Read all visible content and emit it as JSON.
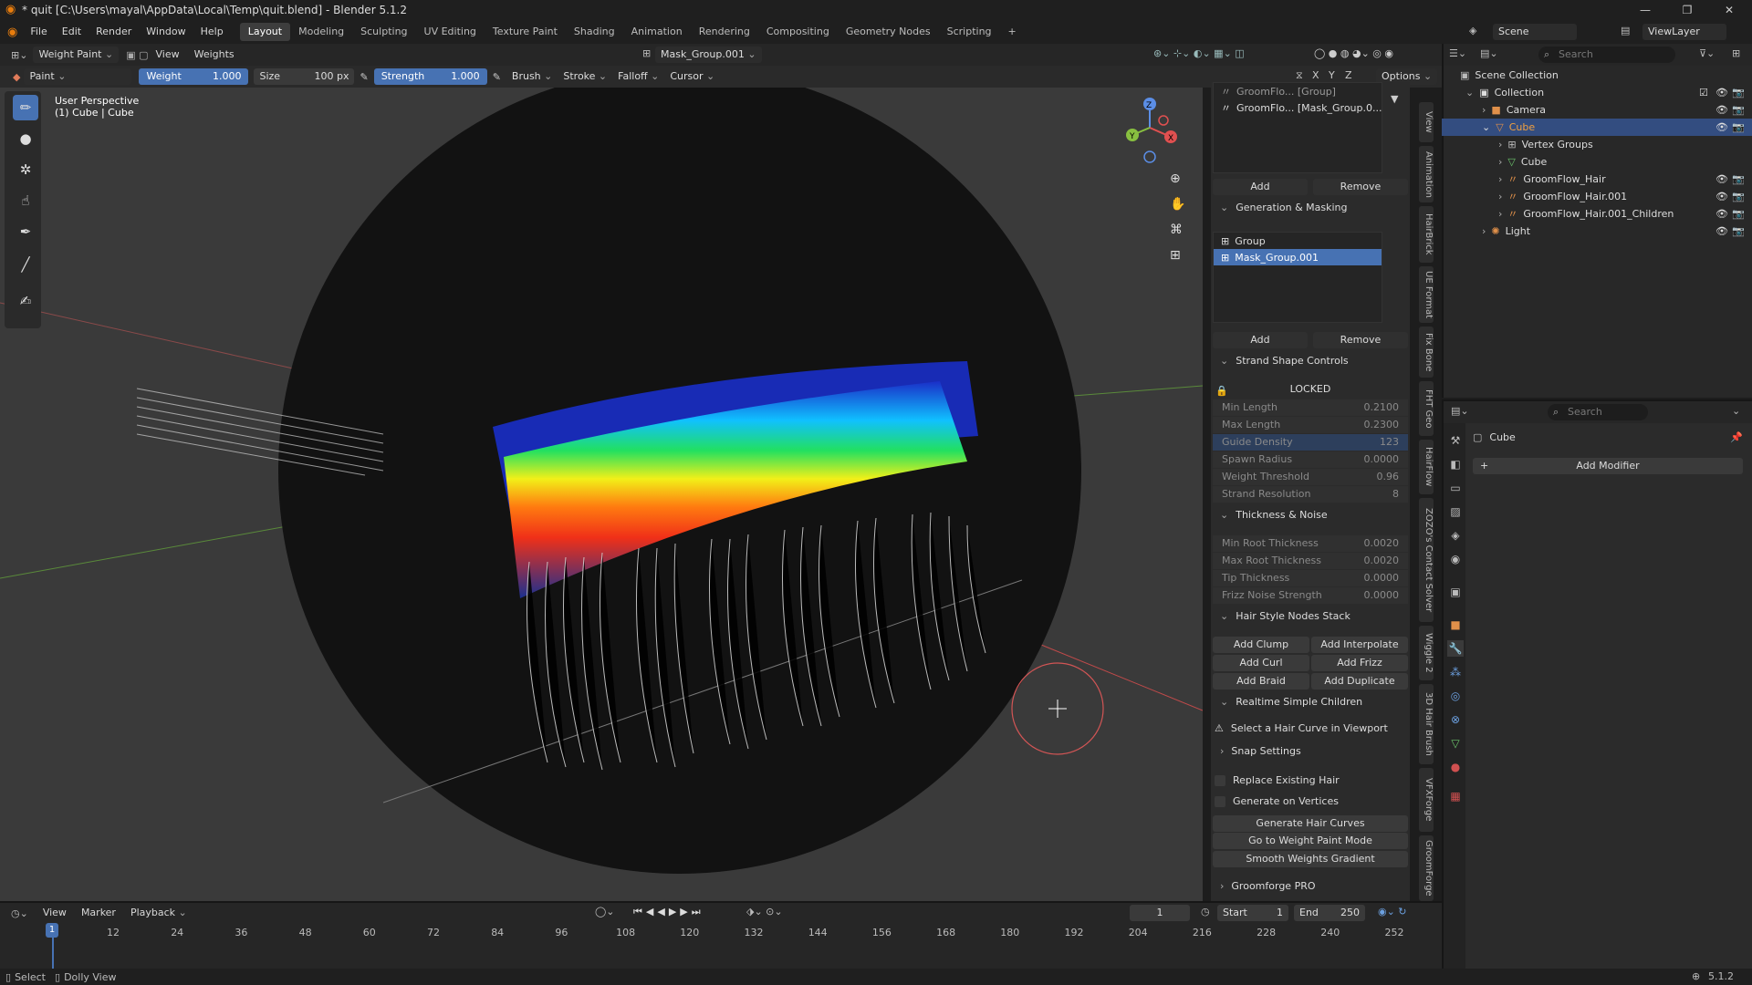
{
  "window": {
    "title": "* quit [C:\\Users\\mayal\\AppData\\Local\\Temp\\quit.blend] - Blender 5.1.2",
    "minimize": "—",
    "maximize": "❐",
    "close": "✕"
  },
  "menu": [
    "File",
    "Edit",
    "Render",
    "Window",
    "Help"
  ],
  "workspaces": [
    "Layout",
    "Modeling",
    "Sculpting",
    "UV Editing",
    "Texture Paint",
    "Shading",
    "Animation",
    "Rendering",
    "Compositing",
    "Geometry Nodes",
    "Scripting",
    "+"
  ],
  "scene": {
    "name": "Scene",
    "viewlayer": "ViewLayer"
  },
  "viewport_header": {
    "mode": "Weight Paint",
    "view": "View",
    "weights": "Weights",
    "vgroup": "Mask_Group.001"
  },
  "tool_header": {
    "brush_name": "Paint",
    "weight_label": "Weight",
    "weight_value": "1.000",
    "size_label": "Size",
    "size_value": "100 px",
    "strength_label": "Strength",
    "strength_value": "1.000",
    "brush": "Brush",
    "stroke": "Stroke",
    "falloff": "Falloff",
    "cursor": "Cursor",
    "options": "Options",
    "x": "X",
    "y": "Y",
    "z": "Z"
  },
  "overlay": {
    "line1": "User Perspective",
    "line2": "(1) Cube | Cube"
  },
  "gizmo": {
    "x": "X",
    "y": "Y",
    "z": "Z"
  },
  "npanel": {
    "list1": [
      {
        "name": "GroomFlo...",
        "detail": "[Group]"
      },
      {
        "name": "GroomFlo...",
        "detail": "[Mask_Group.0..."
      }
    ],
    "add": "Add",
    "remove": "Remove",
    "gen_title": "Generation & Masking",
    "list2": [
      "Group",
      "Mask_Group.001"
    ],
    "strand_title": "Strand Shape Controls",
    "locked": "LOCKED",
    "strand_fields": [
      {
        "label": "Min Length",
        "value": "0.2100"
      },
      {
        "label": "Max Length",
        "value": "0.2300"
      },
      {
        "label": "Guide Density",
        "value": "123"
      },
      {
        "label": "Spawn Radius",
        "value": "0.0000"
      },
      {
        "label": "Weight Threshold",
        "value": "0.96"
      },
      {
        "label": "Strand Resolution",
        "value": "8"
      }
    ],
    "thick_title": "Thickness & Noise",
    "thick_fields": [
      {
        "label": "Min Root Thickness",
        "value": "0.0020"
      },
      {
        "label": "Max Root Thickness",
        "value": "0.0020"
      },
      {
        "label": "Tip Thickness",
        "value": "0.0000"
      },
      {
        "label": "Frizz Noise Strength",
        "value": "0.0000"
      }
    ],
    "stack_title": "Hair Style Nodes Stack",
    "stack_buttons": [
      "Add Clump",
      "Add Interpolate",
      "Add Curl",
      "Add Frizz",
      "Add Braid",
      "Add Duplicate"
    ],
    "children_title": "Realtime Simple Children",
    "warning": "Select a Hair Curve in Viewport",
    "snap_title": "Snap Settings",
    "replace": "Replace Existing Hair",
    "gen_vertices": "Generate on Vertices",
    "gen_curves": "Generate Hair Curves",
    "go_weight": "Go to Weight Paint Mode",
    "smooth": "Smooth Weights Gradient",
    "groomforge": "Groomforge PRO"
  },
  "vtabs": [
    "View",
    "Animation",
    "HairBrick",
    "UE Format",
    "Fix Bone",
    "FHT Geo",
    "HairFlow",
    "ZOZO's Contact Solver",
    "Wiggle 2",
    "3D Hair Brush",
    "VFXForge",
    "GroomForge"
  ],
  "outliner": {
    "search": "Search",
    "scene_collection": "Scene Collection",
    "collection": "Collection",
    "camera": "Camera",
    "cube": "Cube",
    "vertex_groups": "Vertex Groups",
    "cube_mesh": "Cube",
    "hair1": "GroomFlow_Hair",
    "hair2": "GroomFlow_Hair.001",
    "hair3": "GroomFlow_Hair.001_Children",
    "light": "Light"
  },
  "properties": {
    "search": "Search",
    "object": "Cube",
    "add_modifier": "Add Modifier"
  },
  "timeline": {
    "view": "View",
    "marker": "Marker",
    "playback": "Playback",
    "frame": "1",
    "start_label": "Start",
    "start": "1",
    "end_label": "End",
    "end": "250",
    "ticks": [
      "1",
      "12",
      "24",
      "36",
      "48",
      "60",
      "72",
      "84",
      "96",
      "108",
      "120",
      "132",
      "144",
      "156",
      "168",
      "180",
      "192",
      "204",
      "216",
      "228",
      "240",
      "252"
    ]
  },
  "statusbar": {
    "select": "Select",
    "dolly": "Dolly View",
    "version": "5.1.2"
  }
}
